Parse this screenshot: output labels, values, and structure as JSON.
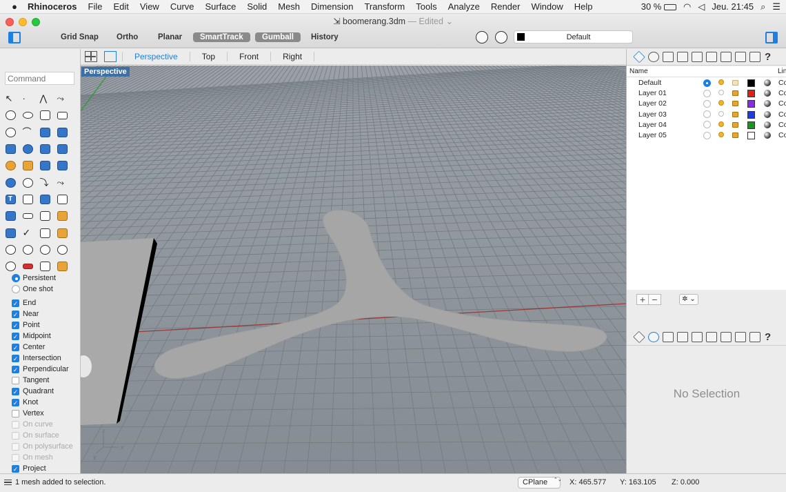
{
  "menubar": {
    "app_name": "Rhinoceros",
    "items": [
      "File",
      "Edit",
      "View",
      "Curve",
      "Surface",
      "Solid",
      "Mesh",
      "Dimension",
      "Transform",
      "Tools",
      "Analyze",
      "Render",
      "Window",
      "Help"
    ],
    "battery": "30 %",
    "clock": "Jeu. 21:45"
  },
  "window": {
    "title": "boomerang.3dm",
    "title_status": "— Edited"
  },
  "toolbar": {
    "grid_snap": "Grid Snap",
    "ortho": "Ortho",
    "planar": "Planar",
    "smarttrack": "SmartTrack",
    "gumball": "Gumball",
    "history": "History",
    "current_layer": "Default"
  },
  "command": {
    "placeholder": "Command"
  },
  "osnap": {
    "persistent": "Persistent",
    "one_shot": "One shot",
    "items": [
      {
        "label": "End",
        "checked": true
      },
      {
        "label": "Near",
        "checked": true
      },
      {
        "label": "Point",
        "checked": true
      },
      {
        "label": "Midpoint",
        "checked": true
      },
      {
        "label": "Center",
        "checked": true
      },
      {
        "label": "Intersection",
        "checked": true
      },
      {
        "label": "Perpendicular",
        "checked": true
      },
      {
        "label": "Tangent",
        "checked": false
      },
      {
        "label": "Quadrant",
        "checked": true
      },
      {
        "label": "Knot",
        "checked": true
      },
      {
        "label": "Vertex",
        "checked": false
      },
      {
        "label": "On curve",
        "checked": false,
        "disabled": true
      },
      {
        "label": "On surface",
        "checked": false,
        "disabled": true
      },
      {
        "label": "On polysurface",
        "checked": false,
        "disabled": true
      },
      {
        "label": "On mesh",
        "checked": false,
        "disabled": true
      },
      {
        "label": "Project",
        "checked": true
      }
    ]
  },
  "viewport": {
    "tabs": [
      "Perspective",
      "Top",
      "Front",
      "Right"
    ],
    "active_tab": "Perspective",
    "label": "Perspective",
    "axis_z": "z",
    "axis_y": "y",
    "axis_x": "x"
  },
  "layers": {
    "col_name": "Name",
    "col_linetype": "Lin",
    "rows": [
      {
        "name": "Default",
        "color": "#000000",
        "current": true,
        "visible": true,
        "locked": false
      },
      {
        "name": "Layer 01",
        "color": "#e02010",
        "current": false,
        "visible": false,
        "locked": true
      },
      {
        "name": "Layer 02",
        "color": "#8a2be2",
        "current": false,
        "visible": true,
        "locked": true
      },
      {
        "name": "Layer 03",
        "color": "#1f3ce0",
        "current": false,
        "visible": false,
        "locked": true
      },
      {
        "name": "Layer 04",
        "color": "#119a1a",
        "current": false,
        "visible": true,
        "locked": true
      },
      {
        "name": "Layer 05",
        "color": "#ffffff",
        "current": false,
        "visible": true,
        "locked": true
      }
    ],
    "linetype_abbrev": "Co",
    "add": "+",
    "remove": "−",
    "gear": "✲ ⌄"
  },
  "properties": {
    "empty_text": "No Selection"
  },
  "status": {
    "message": "1 mesh added to selection.",
    "cplane": "CPlane",
    "x": "X: 465.577",
    "y": "Y: 163.105",
    "z": "Z: 0.000"
  }
}
